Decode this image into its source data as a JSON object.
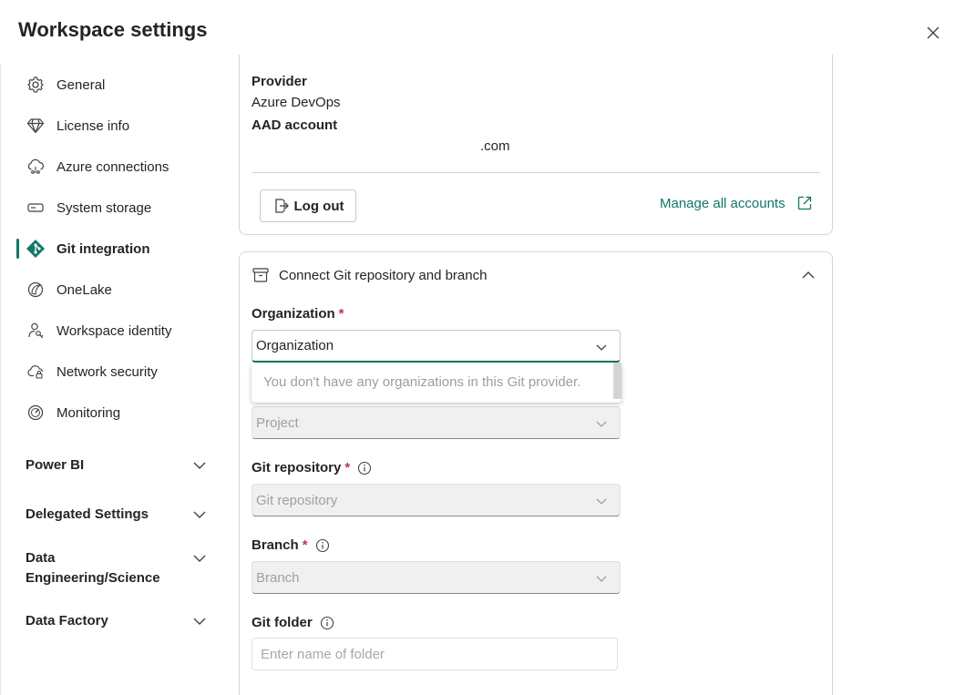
{
  "header": {
    "title": "Workspace settings"
  },
  "sidebar": {
    "items": [
      {
        "label": "General",
        "icon": "gear-icon"
      },
      {
        "label": "License info",
        "icon": "diamond-icon"
      },
      {
        "label": "Azure connections",
        "icon": "cloud-link-icon"
      },
      {
        "label": "System storage",
        "icon": "storage-icon"
      },
      {
        "label": "Git integration",
        "icon": "git-icon",
        "active": true
      },
      {
        "label": "OneLake",
        "icon": "onelake-icon"
      },
      {
        "label": "Workspace identity",
        "icon": "identity-key-icon"
      },
      {
        "label": "Network security",
        "icon": "cloud-lock-icon"
      },
      {
        "label": "Monitoring",
        "icon": "gauge-icon"
      }
    ],
    "groups": [
      {
        "label": "Power BI"
      },
      {
        "label": "Delegated Settings"
      },
      {
        "label": "Data Engineering/Science",
        "line1": "Data",
        "line2": "Engineering/Science"
      },
      {
        "label": "Data Factory"
      }
    ]
  },
  "account": {
    "provider_label": "Provider",
    "provider_value": "Azure DevOps",
    "aad_label": "AAD account",
    "aad_value": ".com",
    "logout_label": "Log out",
    "manage_label": "Manage all accounts"
  },
  "connect": {
    "section_title": "Connect Git repository and branch",
    "organization": {
      "label": "Organization",
      "required": "*",
      "value": "Organization",
      "empty_message": "You don't have any organizations in this Git provider."
    },
    "project": {
      "value": "Project"
    },
    "repository": {
      "label": "Git repository",
      "required": "*",
      "value": "Git repository"
    },
    "branch": {
      "label": "Branch",
      "required": "*",
      "value": "Branch"
    },
    "folder": {
      "label": "Git folder",
      "placeholder": "Enter name of folder"
    }
  },
  "colors": {
    "accent": "#117865",
    "required": "#c4314b"
  }
}
